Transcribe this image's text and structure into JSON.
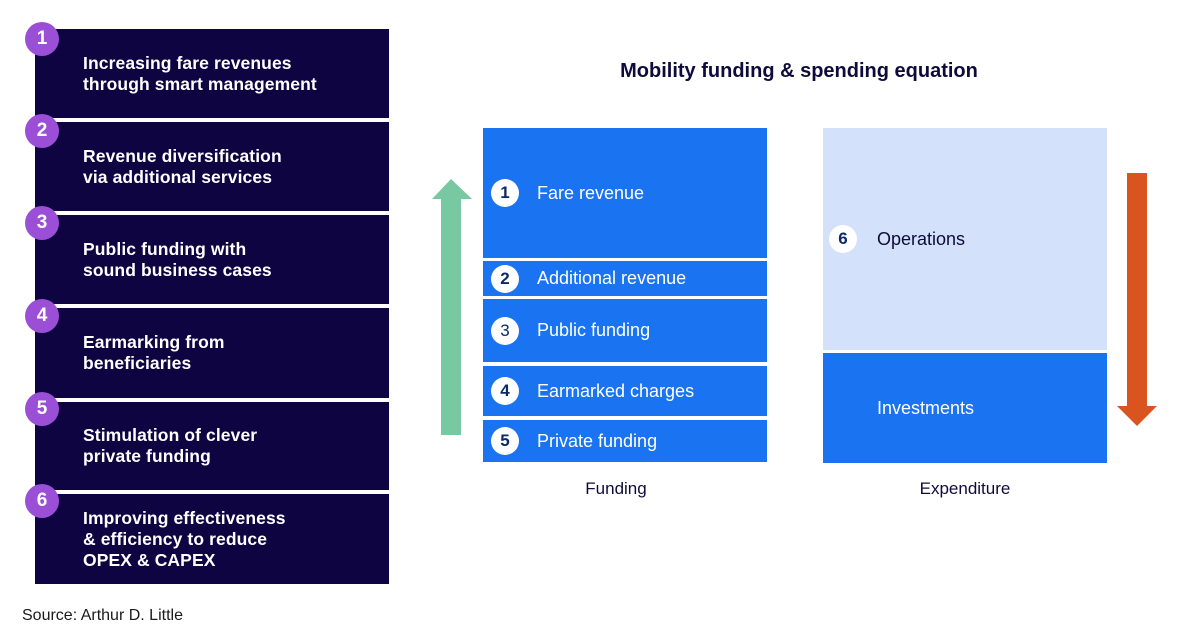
{
  "levers": [
    {
      "number": "1",
      "text": "Increasing fare revenues\nthrough smart management"
    },
    {
      "number": "2",
      "text": "Revenue diversification\nvia additional services"
    },
    {
      "number": "3",
      "text": "Public funding with\nsound business cases"
    },
    {
      "number": "4",
      "text": "Earmarking from\nbeneficiaries"
    },
    {
      "number": "5",
      "text": "Stimulation of clever\nprivate funding"
    },
    {
      "number": "6",
      "text": "Improving effectiveness\n& efficiency to reduce\nOPEX & CAPEX"
    }
  ],
  "equation": {
    "title": "Mobility funding & spending equation",
    "funding": {
      "caption": "Funding",
      "segments": [
        {
          "number": "1",
          "label": "Fare revenue"
        },
        {
          "number": "2",
          "label": "Additional revenue"
        },
        {
          "number": "3",
          "label": "Public funding"
        },
        {
          "number": "4",
          "label": "Earmarked charges"
        },
        {
          "number": "5",
          "label": "Private funding"
        }
      ]
    },
    "expenditure": {
      "caption": "Expenditure",
      "segments": [
        {
          "number": "6",
          "label": "Operations"
        },
        {
          "number": "",
          "label": "Investments"
        }
      ]
    }
  },
  "colors": {
    "lever_bg": "#0f0442",
    "badge": "#9b4fd6",
    "blue": "#1a74f2",
    "light_blue": "#d3e2fa",
    "up_arrow": "#78c9a1",
    "down_arrow": "#d9541e"
  },
  "source": "Source: Arthur D. Little"
}
